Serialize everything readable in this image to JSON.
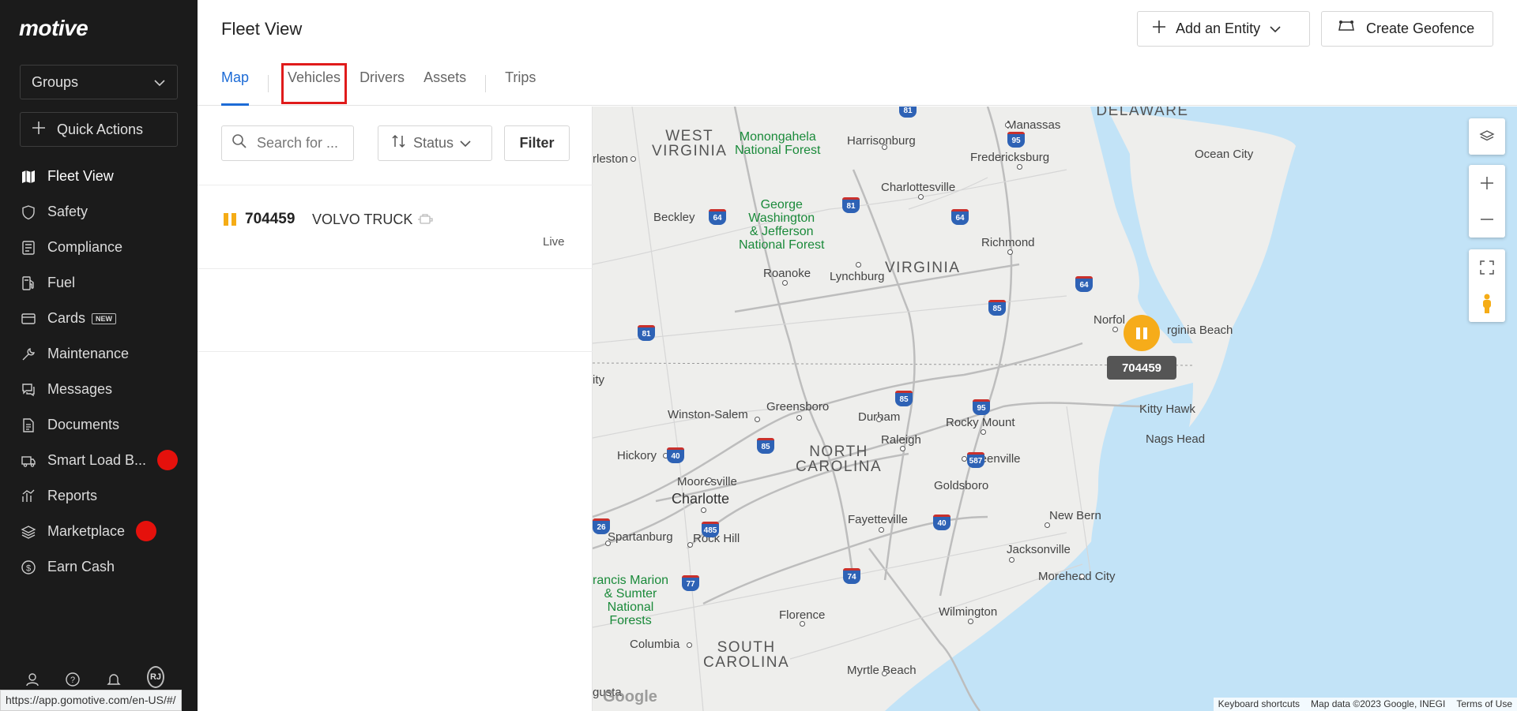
{
  "app": {
    "logo": "motive"
  },
  "sidebar": {
    "groups_label": "Groups",
    "quick_actions_label": "Quick Actions",
    "items": [
      {
        "label": "Fleet View",
        "icon": "map-icon",
        "active": true
      },
      {
        "label": "Safety",
        "icon": "shield-icon"
      },
      {
        "label": "Compliance",
        "icon": "document-list-icon"
      },
      {
        "label": "Fuel",
        "icon": "fuel-pump-icon"
      },
      {
        "label": "Cards",
        "icon": "card-icon",
        "badge": "NEW"
      },
      {
        "label": "Maintenance",
        "icon": "wrench-icon"
      },
      {
        "label": "Messages",
        "icon": "chat-icon"
      },
      {
        "label": "Documents",
        "icon": "document-icon"
      },
      {
        "label": "Smart Load B...",
        "icon": "truck-icon",
        "dot_color": "#e5110c"
      },
      {
        "label": "Reports",
        "icon": "chart-icon"
      },
      {
        "label": "Marketplace",
        "icon": "layers-icon",
        "dot_color": "#e5110c"
      },
      {
        "label": "Earn Cash",
        "icon": "dollar-icon"
      }
    ],
    "avatar_initials": "RJ"
  },
  "status_url": "https://app.gomotive.com/en-US/#/",
  "header": {
    "title": "Fleet View",
    "add_entity_label": "Add an Entity",
    "create_geofence_label": "Create Geofence",
    "tabs": [
      {
        "label": "Map",
        "active": true
      },
      {
        "label": "Vehicles",
        "highlighted": true
      },
      {
        "label": "Drivers"
      },
      {
        "label": "Assets"
      },
      {
        "label": "Trips"
      }
    ]
  },
  "list": {
    "search_placeholder": "Search for ...",
    "status_label": "Status",
    "filter_label": "Filter",
    "vehicles": [
      {
        "id": "704459",
        "name": "VOLVO TRUCK",
        "status": "Live"
      }
    ]
  },
  "map": {
    "marker_label": "704459",
    "accent_color": "#f6ac1a",
    "footer": {
      "shortcuts": "Keyboard shortcuts",
      "data": "Map data ©2023 Google, INEGI",
      "terms": "Terms of Use"
    },
    "google_logo": "Google",
    "labels": {
      "delaware": "DELAWARE",
      "manassas": "Manassas",
      "ocean_city": "Ocean City",
      "west_virginia": "WEST\nVIRGINIA",
      "monongahela": "Monongahela\nNational Forest",
      "harrisonburg": "Harrisonburg",
      "fredericksburg": "Fredericksburg",
      "charleston": "rleston",
      "charlottesville": "Charlottesville",
      "george_washington": "George\nWashington\n& Jefferson\nNational Forest",
      "beckley": "Beckley",
      "richmond": "Richmond",
      "virginia": "VIRGINIA",
      "roanoke": "Roanoke",
      "lynchburg": "Lynchburg",
      "norfolk": "Norfol",
      "virginia_beach": "rginia Beach",
      "city_edge": "ity",
      "winston_salem": "Winston-Salem",
      "greensboro": "Greensboro",
      "durham": "Durham",
      "rocky_mount": "Rocky Mount",
      "kitty_hawk": "Kitty Hawk",
      "nags_head": "Nags Head",
      "hickory": "Hickory",
      "north_carolina": "NORTH\nCAROLINA",
      "raleigh": "Raleigh",
      "greenville": "Greenville",
      "mooresville": "Mooresville",
      "goldsboro": "Goldsboro",
      "charlotte": "Charlotte",
      "fayetteville": "Fayetteville",
      "new_bern": "New Bern",
      "spartanburg": "Spartanburg",
      "rock_hill": "Rock Hill",
      "jacksonville": "Jacksonville",
      "morehead_city": "Morehead City",
      "francis_marion": "rancis Marion\n& Sumter\nNational\nForests",
      "florence": "Florence",
      "wilmington": "Wilmington",
      "columbia": "Columbia",
      "south_carolina": "SOUTH\nCAROLINA",
      "myrtle_beach": "Myrtle Beach",
      "augusta": "gusta"
    },
    "shields": [
      "81",
      "95",
      "64",
      "81",
      "64",
      "64",
      "85",
      "81",
      "85",
      "95",
      "40",
      "85",
      "587",
      "40",
      "485",
      "77",
      "74",
      "40",
      "26"
    ]
  }
}
